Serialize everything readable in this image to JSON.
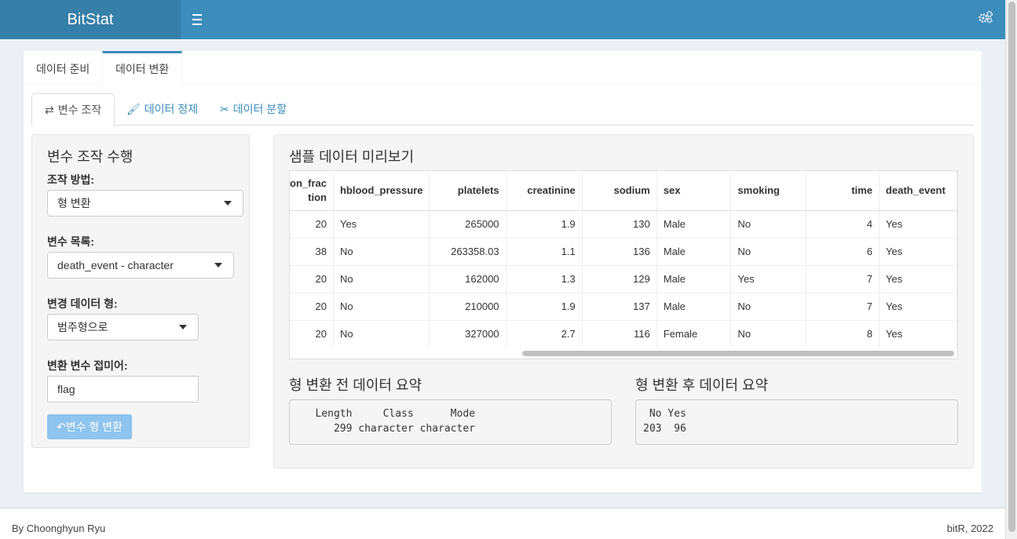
{
  "app": {
    "title": "BitStat"
  },
  "outer_tabs": [
    {
      "label": "데이터 준비"
    },
    {
      "label": "데이터 변환"
    }
  ],
  "inner_tabs": [
    {
      "label": "변수 조작",
      "icon": "exchange-icon"
    },
    {
      "label": "데이터 정제",
      "icon": "paint-brush-icon"
    },
    {
      "label": "데이터 분할",
      "icon": "scissors-icon"
    }
  ],
  "sidebar": {
    "title": "변수 조작 수행",
    "method_label": "조작 방법:",
    "method_value": "형 변환",
    "varlist_label": "변수 목록:",
    "varlist_value": "death_event - character",
    "newtype_label": "변경 데이터 형:",
    "newtype_value": "범주형으로",
    "suffix_label": "변환 변수 접미어:",
    "suffix_value": "flag",
    "button_label": "변수 형 변환"
  },
  "preview": {
    "title": "샘플 데이터 미리보기",
    "columns": [
      "on_frac tion",
      "hblood_pressure",
      "platelets",
      "creatinine",
      "sodium",
      "sex",
      "smoking",
      "time",
      "death_event"
    ],
    "rows": [
      [
        "20",
        "Yes",
        "265000",
        "1.9",
        "130",
        "Male",
        "No",
        "4",
        "Yes"
      ],
      [
        "38",
        "No",
        "263358.03",
        "1.1",
        "136",
        "Male",
        "No",
        "6",
        "Yes"
      ],
      [
        "20",
        "No",
        "162000",
        "1.3",
        "129",
        "Male",
        "Yes",
        "7",
        "Yes"
      ],
      [
        "20",
        "No",
        "210000",
        "1.9",
        "137",
        "Male",
        "No",
        "7",
        "Yes"
      ],
      [
        "20",
        "No",
        "327000",
        "2.7",
        "116",
        "Female",
        "No",
        "8",
        "Yes"
      ]
    ]
  },
  "summary_before": {
    "title": "형 변환 전 데이터 요약",
    "line1": "   Length     Class      Mode",
    "line2": "      299 character character"
  },
  "summary_after": {
    "title": "형 변환 후 데이터 요약",
    "line1": " No Yes",
    "line2": "203  96"
  },
  "footer": {
    "left": "By Choonghyun Ryu",
    "right": "bitR, 2022"
  },
  "colors": {
    "header": "#3c8dbc",
    "logo_bg": "#367fa9",
    "button": "#8ec4ee"
  }
}
